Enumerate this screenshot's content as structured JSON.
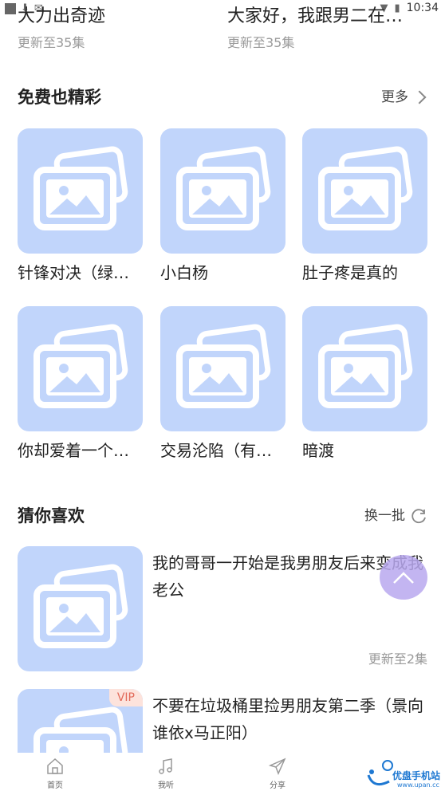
{
  "status_bar": {
    "time": "10:34"
  },
  "top_row": [
    {
      "title": "大力出奇迹",
      "subtitle": "更新至35集"
    },
    {
      "title": "大家好，我跟男二在一…",
      "subtitle": "更新至35集"
    }
  ],
  "free_section": {
    "title": "免费也精彩",
    "more_label": "更多",
    "items": [
      {
        "label": "针锋对决（绿…"
      },
      {
        "label": "小白杨"
      },
      {
        "label": "肚子疼是真的"
      },
      {
        "label": "你却爱着一个…"
      },
      {
        "label": "交易沦陷（有…"
      },
      {
        "label": "暗渡"
      }
    ]
  },
  "guess_section": {
    "title": "猜你喜欢",
    "refresh_label": "换一批",
    "items": [
      {
        "title": "我的哥哥一开始是我男朋友后来变成我老公",
        "meta": "更新至2集",
        "badge": ""
      },
      {
        "title": "不要在垃圾桶里捡男朋友第二季（景向谁依x马正阳）",
        "meta": "",
        "badge": "VIP"
      }
    ]
  },
  "tab_bar": {
    "tabs": [
      {
        "label": "首页",
        "icon": "home-icon"
      },
      {
        "label": "我听",
        "icon": "music-note-icon"
      },
      {
        "label": "分享",
        "icon": "paper-plane-icon"
      }
    ]
  },
  "watermark": {
    "text": "优盘手机站",
    "sub": "www.upan.cc"
  },
  "colors": {
    "placeholder": "#c1d5fb",
    "fab": "#b8a8ee",
    "vip": "#e26a5a"
  }
}
